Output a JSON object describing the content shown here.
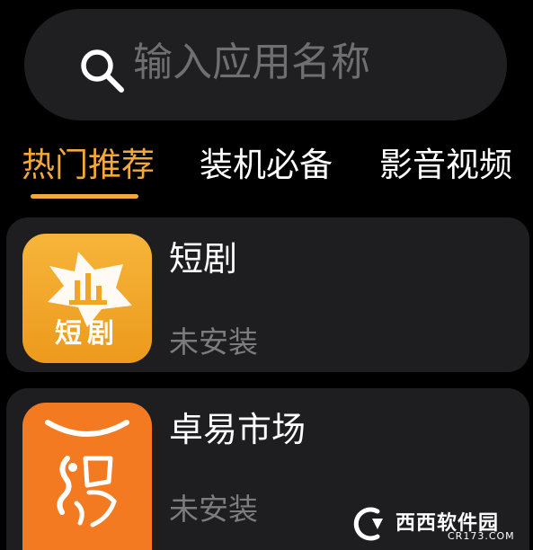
{
  "search": {
    "placeholder": "输入应用名称",
    "value": "",
    "icon": "search-icon"
  },
  "tabs": [
    {
      "label": "热门推荐",
      "active": true
    },
    {
      "label": "装机必备",
      "active": false
    },
    {
      "label": "影音视频",
      "active": false
    }
  ],
  "apps": [
    {
      "name": "短剧",
      "status": "未安装",
      "icon": "duanju-app-icon",
      "icon_label": "短剧",
      "icon_color": "#f1a127"
    },
    {
      "name": "卓易市场",
      "status": "未安装",
      "icon": "zhuoyi-market-app-icon",
      "icon_color": "#f47a21"
    }
  ],
  "watermark": {
    "text": "西西软件园",
    "sub": "CR173.COM"
  },
  "colors": {
    "background": "#000000",
    "surface": "#1e1e20",
    "accent": "#f2a93b",
    "text_primary": "#ffffff",
    "text_secondary": "#7c7c80",
    "placeholder": "#6f6f72"
  }
}
